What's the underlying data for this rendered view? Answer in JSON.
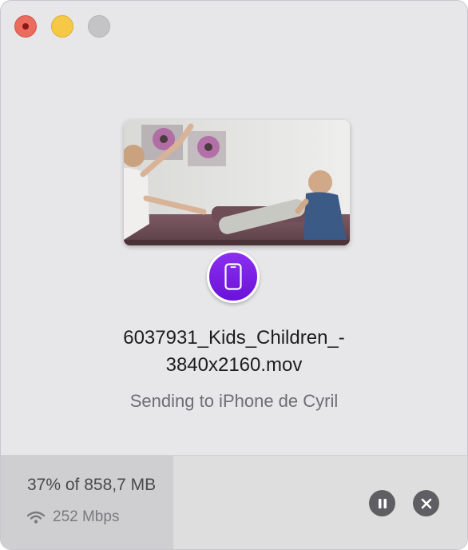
{
  "window": {
    "controls": [
      "close",
      "minimize",
      "zoom"
    ]
  },
  "transfer": {
    "filename_line1": "6037931_Kids_Children_-",
    "filename_line2": "3840x2160.mov",
    "status": "Sending to iPhone de Cyril",
    "device_icon": "iphone-icon"
  },
  "footer": {
    "progress_text": "37% of 858,7 MB",
    "progress_percent": 37,
    "speed": "252 Mbps",
    "speed_icon": "wifi-icon",
    "pause_icon": "pause-icon",
    "stop_icon": "stop-icon"
  },
  "colors": {
    "badge": "#7a1fe6",
    "window_bg": "#e7e7ea",
    "footer_bg": "#dededf",
    "progress_fill": "#cfcfd1"
  }
}
